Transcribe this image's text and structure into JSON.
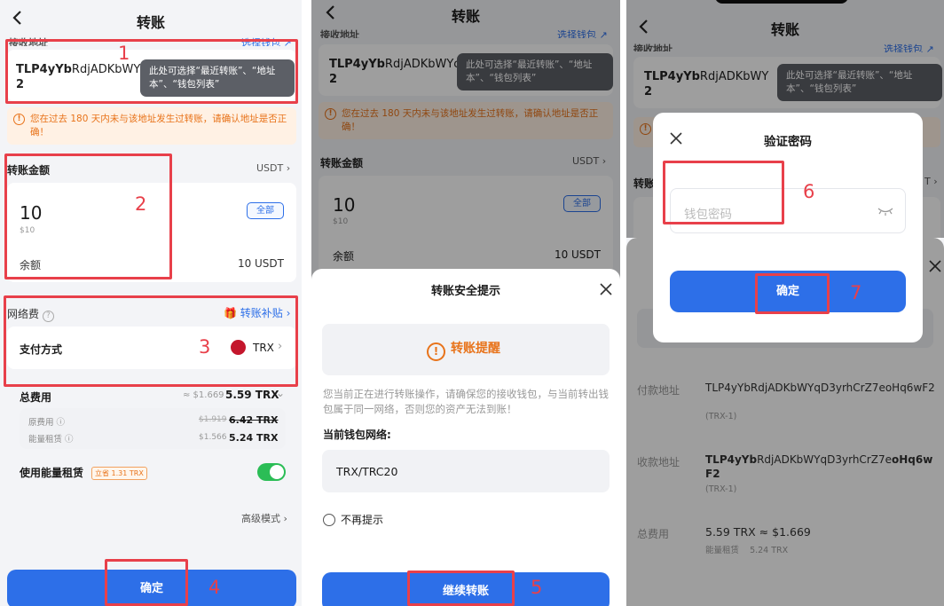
{
  "screen1": {
    "title": "转账",
    "receive_label": "接收地址",
    "choose_wallet": "选择钱包 ↗",
    "address_line1_bold": "TLP4yYb",
    "address_line1_rest": "RdjADKbWYc",
    "address_line2": "2",
    "tooltip": "此处可选择“最近转账”、“地址本”、“钱包列表”",
    "warning": "您在过去 180 天内未与该地址发生过转账，请确认地址是否正确！",
    "amount_label": "转账金额",
    "currency": "USDT ›",
    "amount_value": "10",
    "amount_fiat": "$10",
    "all_button": "全部",
    "balance_label": "余额",
    "balance_value": "10 USDT",
    "fee_label": "网络费",
    "subsidy": "转账补贴 ›",
    "pay_method_label": "支付方式",
    "pay_method_value": "TRX",
    "total_label": "总费用",
    "total_fiat": "≈ $1.669",
    "total_value": "5.59 TRX",
    "orig_fee_label": "原费用",
    "orig_fee_fiat": "$1.919",
    "orig_fee_value": "6.42 TRX",
    "energy_label": "能量租赁",
    "energy_fiat": "$1.566",
    "energy_value": "5.24 TRX",
    "use_energy_label": "使用能量租赁",
    "save_badge": "立省 1.31 TRX",
    "advanced": "高级模式 ›",
    "confirm": "确定",
    "annotations": [
      "1",
      "2",
      "3",
      "4"
    ]
  },
  "screen2": {
    "title": "转账",
    "receive_label": "接收地址",
    "choose_wallet": "选择钱包 ↗",
    "address_line1_bold": "TLP4yYb",
    "address_line1_rest": "RdjADKbWYc",
    "address_line2": "2",
    "tooltip": "此处可选择“最近转账”、“地址本”、“钱包列表”",
    "warning": "您在过去 180 天内未与该地址发生过转账，请确认地址是否正确！",
    "amount_label": "转账金额",
    "currency": "USDT ›",
    "amount_value": "10",
    "amount_fiat": "$10",
    "all_button": "全部",
    "balance_label": "余额",
    "balance_value": "10 USDT",
    "sheet_title": "转账安全提示",
    "reminder_title": "转账提醒",
    "reminder_text": "您当前正在进行转账操作，请确保您的接收钱包，与当前转出钱包属于同一网络，否则您的资产无法到账！",
    "network_label": "当前钱包网络:",
    "network_value": "TRX/TRC20",
    "no_remind": "不再提示",
    "continue": "继续转账",
    "annotations": [
      "5"
    ]
  },
  "screen3": {
    "title": "转账",
    "receive_label": "接收地址",
    "choose_wallet": "选择钱包 ↗",
    "address_line1_bold": "TLP4yYb",
    "address_line1_rest": "RdjADKbWY",
    "address_line2": "2",
    "tooltip": "此处可选择“最近转账”、“地址本”、“钱包列表”",
    "amount_label": "转账",
    "currency": "T ›",
    "dialog_title": "验证密码",
    "password_placeholder": "钱包密码",
    "confirm": "确定",
    "pay_address_label": "付款地址",
    "pay_address": "TLP4yYbRdjADKbWYqD3yrhCrZ7eoHq6wF2",
    "pay_network": "(TRX-1)",
    "recv_address_label": "收款地址",
    "recv_address_bold1": "TLP4yYb",
    "recv_address_mid": "RdjADKbWYqD3yrhCrZ7e",
    "recv_address_bold2": "oHq6wF2",
    "recv_network": "(TRX-1)",
    "total_label": "总费用",
    "total_value": "5.59 TRX ≈ $1.669",
    "energy_line": "能量租赁    5.24 TRX",
    "annotations": [
      "6",
      "7"
    ]
  },
  "colors": {
    "accent": "#2d6fe8",
    "annotation": "#e8404a",
    "warning": "#e8731a",
    "toggle": "#2bbd56",
    "tron": "#c4162c"
  }
}
